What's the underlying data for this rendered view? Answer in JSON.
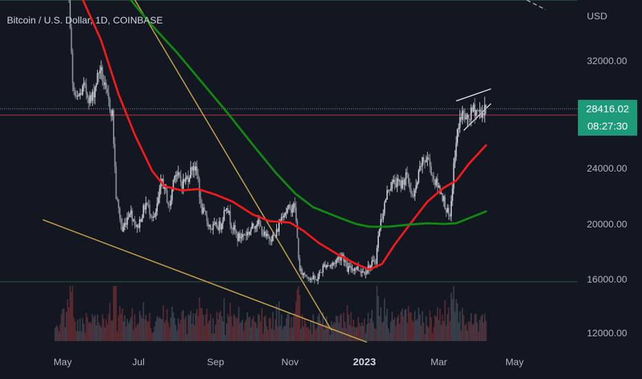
{
  "header": {
    "symbol_title": "Bitcoin / U.S. Dollar, 1D, COINBASE",
    "currency": "USD"
  },
  "colors": {
    "background": "#131722",
    "up": "#c9ccd3",
    "down": "#8f939c",
    "ma_fast": "#f01b1b",
    "ma_slow": "#128a12",
    "trendline": "#c9a24a",
    "price_badge": "#1c9a7a",
    "price_line": "#e8384c"
  },
  "chart_data": {
    "type": "candlestick",
    "x_axis_labels": [
      "May",
      "Jul",
      "Sep",
      "Nov",
      "2023",
      "Mar",
      "May"
    ],
    "y_axis_labels": [
      "32000.00",
      "24000.00",
      "20000.00",
      "16000.00",
      "12000.00"
    ],
    "ylim": [
      11000,
      37000
    ],
    "xlim": [
      "2022-04-15",
      "2023-06-01"
    ],
    "current_price": {
      "value": 28416.02,
      "label": "28416.02",
      "countdown": "08:27:30"
    },
    "price_series": [
      [
        "2022-04-25",
        40000
      ],
      [
        "2022-05-04",
        39500
      ],
      [
        "2022-05-07",
        35000
      ],
      [
        "2022-05-09",
        30000
      ],
      [
        "2022-05-12",
        29000
      ],
      [
        "2022-05-18",
        30000
      ],
      [
        "2022-05-24",
        29000
      ],
      [
        "2022-05-31",
        31500
      ],
      [
        "2022-06-05",
        29500
      ],
      [
        "2022-06-10",
        28000
      ],
      [
        "2022-06-13",
        22000
      ],
      [
        "2022-06-18",
        19500
      ],
      [
        "2022-06-24",
        21000
      ],
      [
        "2022-06-30",
        19700
      ],
      [
        "2022-07-07",
        21500
      ],
      [
        "2022-07-14",
        20300
      ],
      [
        "2022-07-20",
        23200
      ],
      [
        "2022-07-26",
        21100
      ],
      [
        "2022-07-30",
        23800
      ],
      [
        "2022-08-05",
        22900
      ],
      [
        "2022-08-10",
        23400
      ],
      [
        "2022-08-14",
        24300
      ],
      [
        "2022-08-18",
        23200
      ],
      [
        "2022-08-20",
        21200
      ],
      [
        "2022-08-28",
        19700
      ],
      [
        "2022-09-05",
        19900
      ],
      [
        "2022-09-10",
        21500
      ],
      [
        "2022-09-13",
        20200
      ],
      [
        "2022-09-19",
        19000
      ],
      [
        "2022-09-28",
        19400
      ],
      [
        "2022-10-05",
        20200
      ],
      [
        "2022-10-12",
        19000
      ],
      [
        "2022-10-20",
        19100
      ],
      [
        "2022-10-26",
        20800
      ],
      [
        "2022-11-05",
        21300
      ],
      [
        "2022-11-09",
        16500
      ],
      [
        "2022-11-14",
        16300
      ],
      [
        "2022-11-22",
        15900
      ],
      [
        "2022-11-30",
        17100
      ],
      [
        "2022-12-05",
        17000
      ],
      [
        "2022-12-14",
        17800
      ],
      [
        "2022-12-18",
        16700
      ],
      [
        "2022-12-25",
        16840
      ],
      [
        "2022-12-31",
        16550
      ],
      [
        "2023-01-06",
        16950
      ],
      [
        "2023-01-10",
        17400
      ],
      [
        "2023-01-13",
        19800
      ],
      [
        "2023-01-20",
        22600
      ],
      [
        "2023-01-25",
        23000
      ],
      [
        "2023-01-30",
        22800
      ],
      [
        "2023-02-03",
        23500
      ],
      [
        "2023-02-09",
        21800
      ],
      [
        "2023-02-15",
        24300
      ],
      [
        "2023-02-20",
        24800
      ],
      [
        "2023-02-25",
        23200
      ],
      [
        "2023-03-03",
        22300
      ],
      [
        "2023-03-10",
        20200
      ],
      [
        "2023-03-13",
        24100
      ],
      [
        "2023-03-17",
        27400
      ],
      [
        "2023-03-20",
        28000
      ],
      [
        "2023-03-24",
        27500
      ],
      [
        "2023-03-29",
        28400
      ],
      [
        "2023-04-02",
        28200
      ],
      [
        "2023-04-06",
        28100
      ],
      [
        "2023-04-08",
        28416.02
      ]
    ],
    "series": [
      {
        "type": "line",
        "points": [
          [
            "2022-05-15",
            37000
          ],
          [
            "2022-06-01",
            33500
          ],
          [
            "2022-06-15",
            29500
          ],
          [
            "2022-06-28",
            26500
          ],
          [
            "2022-07-12",
            23800
          ],
          [
            "2022-07-22",
            22700
          ],
          [
            "2022-08-05",
            22400
          ],
          [
            "2022-08-18",
            22500
          ],
          [
            "2022-09-01",
            22100
          ],
          [
            "2022-09-15",
            21600
          ],
          [
            "2022-10-01",
            20700
          ],
          [
            "2022-10-15",
            20200
          ],
          [
            "2022-11-01",
            20100
          ],
          [
            "2022-11-12",
            19500
          ],
          [
            "2022-11-25",
            18600
          ],
          [
            "2022-12-10",
            17800
          ],
          [
            "2022-12-25",
            17100
          ],
          [
            "2023-01-05",
            16700
          ],
          [
            "2023-01-15",
            17100
          ],
          [
            "2023-01-25",
            18500
          ],
          [
            "2023-02-08",
            20200
          ],
          [
            "2023-02-20",
            21600
          ],
          [
            "2023-03-05",
            22600
          ],
          [
            "2023-03-15",
            23100
          ],
          [
            "2023-03-25",
            24300
          ],
          [
            "2023-04-08",
            25700
          ]
        ]
      },
      {
        "type": "line",
        "points": [
          [
            "2022-06-25",
            36500
          ],
          [
            "2022-07-10",
            34800
          ],
          [
            "2022-08-01",
            32600
          ],
          [
            "2022-08-20",
            30500
          ],
          [
            "2022-09-10",
            28200
          ],
          [
            "2022-10-01",
            25800
          ],
          [
            "2022-10-20",
            23700
          ],
          [
            "2022-11-05",
            22200
          ],
          [
            "2022-11-20",
            21200
          ],
          [
            "2022-12-10",
            20500
          ],
          [
            "2022-12-25",
            20000
          ],
          [
            "2023-01-05",
            19800
          ],
          [
            "2023-01-20",
            19800
          ],
          [
            "2023-02-05",
            19950
          ],
          [
            "2023-02-20",
            20050
          ],
          [
            "2023-03-05",
            20000
          ],
          [
            "2023-03-15",
            20050
          ],
          [
            "2023-03-25",
            20400
          ],
          [
            "2023-04-08",
            20900
          ]
        ]
      }
    ],
    "trendlines": [
      {
        "from": [
          "2022-04-15",
          20300
        ],
        "to": [
          "2023-01-03",
          11300
        ]
      },
      {
        "from": [
          "2022-06-25",
          37000
        ],
        "to": [
          "2022-12-05",
          12200
        ]
      },
      {
        "from": [
          "2023-03-15",
          29000
        ],
        "to": [
          "2023-04-12",
          29900
        ]
      },
      {
        "from": [
          "2023-03-21",
          26800
        ],
        "to": [
          "2023-04-12",
          28800
        ]
      }
    ],
    "horizontal_levels": [
      36500,
      27950,
      15800
    ],
    "ray": {
      "from": [
        "2023-04-26",
        37200
      ],
      "to": [
        "2023-05-26",
        35800
      ]
    }
  }
}
